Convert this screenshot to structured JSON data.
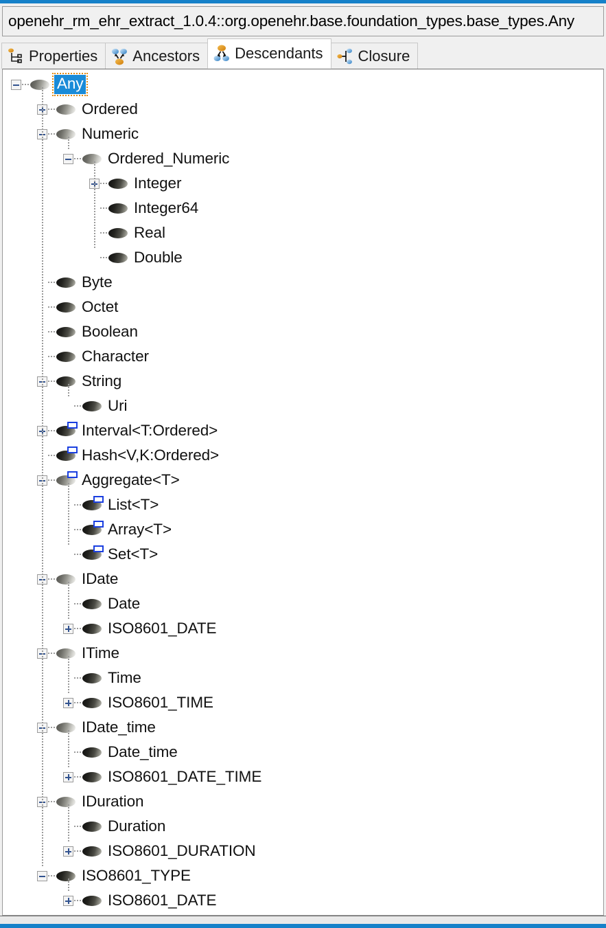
{
  "window": {
    "path_value": "openehr_rm_ehr_extract_1.0.4::org.openehr.base.foundation_types.base_types.Any",
    "accent_color": "#1681c9"
  },
  "tabs": [
    {
      "id": "properties",
      "label": "Properties",
      "icon": "properties-icon",
      "active": false
    },
    {
      "id": "ancestors",
      "label": "Ancestors",
      "icon": "ancestors-icon",
      "active": false
    },
    {
      "id": "descendants",
      "label": "Descendants",
      "icon": "descendants-icon",
      "active": true
    },
    {
      "id": "closure",
      "label": "Closure",
      "icon": "closure-icon",
      "active": false
    }
  ],
  "tree": {
    "selected": "Any",
    "nodes": [
      {
        "label": "Any",
        "level": 0,
        "expander": "minus",
        "icon": "class-abstract-icon",
        "generic": false,
        "selected": true
      },
      {
        "label": "Ordered",
        "level": 1,
        "expander": "plus",
        "icon": "class-abstract-icon",
        "generic": false,
        "selected": false
      },
      {
        "label": "Numeric",
        "level": 1,
        "expander": "minus",
        "icon": "class-abstract-icon",
        "generic": false,
        "selected": false
      },
      {
        "label": "Ordered_Numeric",
        "level": 2,
        "expander": "minus",
        "icon": "class-abstract-icon",
        "generic": false,
        "selected": false
      },
      {
        "label": "Integer",
        "level": 3,
        "expander": "plus",
        "icon": "class-concrete-icon",
        "generic": false,
        "selected": false
      },
      {
        "label": "Integer64",
        "level": 3,
        "expander": "none",
        "icon": "class-concrete-icon",
        "generic": false,
        "selected": false
      },
      {
        "label": "Real",
        "level": 3,
        "expander": "none",
        "icon": "class-concrete-icon",
        "generic": false,
        "selected": false
      },
      {
        "label": "Double",
        "level": 3,
        "expander": "none",
        "icon": "class-concrete-icon",
        "generic": false,
        "selected": false
      },
      {
        "label": "Byte",
        "level": 1,
        "expander": "none",
        "icon": "class-concrete-icon",
        "generic": false,
        "selected": false
      },
      {
        "label": "Octet",
        "level": 1,
        "expander": "none",
        "icon": "class-concrete-icon",
        "generic": false,
        "selected": false
      },
      {
        "label": "Boolean",
        "level": 1,
        "expander": "none",
        "icon": "class-concrete-icon",
        "generic": false,
        "selected": false
      },
      {
        "label": "Character",
        "level": 1,
        "expander": "none",
        "icon": "class-concrete-icon",
        "generic": false,
        "selected": false
      },
      {
        "label": "String",
        "level": 1,
        "expander": "minus",
        "icon": "class-concrete-icon",
        "generic": false,
        "selected": false
      },
      {
        "label": "Uri",
        "level": 2,
        "expander": "none",
        "icon": "class-concrete-icon",
        "generic": false,
        "selected": false
      },
      {
        "label": "Interval<T:Ordered>",
        "level": 1,
        "expander": "plus",
        "icon": "class-concrete-icon",
        "generic": true,
        "selected": false
      },
      {
        "label": "Hash<V,K:Ordered>",
        "level": 1,
        "expander": "none",
        "icon": "class-concrete-icon",
        "generic": true,
        "selected": false
      },
      {
        "label": "Aggregate<T>",
        "level": 1,
        "expander": "minus",
        "icon": "class-abstract-icon",
        "generic": true,
        "selected": false
      },
      {
        "label": "List<T>",
        "level": 2,
        "expander": "none",
        "icon": "class-concrete-icon",
        "generic": true,
        "selected": false
      },
      {
        "label": "Array<T>",
        "level": 2,
        "expander": "none",
        "icon": "class-concrete-icon",
        "generic": true,
        "selected": false
      },
      {
        "label": "Set<T>",
        "level": 2,
        "expander": "none",
        "icon": "class-concrete-icon",
        "generic": true,
        "selected": false
      },
      {
        "label": "IDate",
        "level": 1,
        "expander": "minus",
        "icon": "class-abstract-icon",
        "generic": false,
        "selected": false
      },
      {
        "label": "Date",
        "level": 2,
        "expander": "none",
        "icon": "class-concrete-icon",
        "generic": false,
        "selected": false
      },
      {
        "label": "ISO8601_DATE",
        "level": 2,
        "expander": "plus",
        "icon": "class-concrete-icon",
        "generic": false,
        "selected": false
      },
      {
        "label": "ITime",
        "level": 1,
        "expander": "minus",
        "icon": "class-abstract-icon",
        "generic": false,
        "selected": false
      },
      {
        "label": "Time",
        "level": 2,
        "expander": "none",
        "icon": "class-concrete-icon",
        "generic": false,
        "selected": false
      },
      {
        "label": "ISO8601_TIME",
        "level": 2,
        "expander": "plus",
        "icon": "class-concrete-icon",
        "generic": false,
        "selected": false
      },
      {
        "label": "IDate_time",
        "level": 1,
        "expander": "minus",
        "icon": "class-abstract-icon",
        "generic": false,
        "selected": false
      },
      {
        "label": "Date_time",
        "level": 2,
        "expander": "none",
        "icon": "class-concrete-icon",
        "generic": false,
        "selected": false
      },
      {
        "label": "ISO8601_DATE_TIME",
        "level": 2,
        "expander": "plus",
        "icon": "class-concrete-icon",
        "generic": false,
        "selected": false
      },
      {
        "label": "IDuration",
        "level": 1,
        "expander": "minus",
        "icon": "class-abstract-icon",
        "generic": false,
        "selected": false
      },
      {
        "label": "Duration",
        "level": 2,
        "expander": "none",
        "icon": "class-concrete-icon",
        "generic": false,
        "selected": false
      },
      {
        "label": "ISO8601_DURATION",
        "level": 2,
        "expander": "plus",
        "icon": "class-concrete-icon",
        "generic": false,
        "selected": false
      },
      {
        "label": "ISO8601_TYPE",
        "level": 1,
        "expander": "minus",
        "icon": "class-concrete-icon",
        "generic": false,
        "selected": false
      },
      {
        "label": "ISO8601_DATE",
        "level": 2,
        "expander": "plus",
        "icon": "class-concrete-icon",
        "generic": false,
        "selected": false
      }
    ]
  }
}
